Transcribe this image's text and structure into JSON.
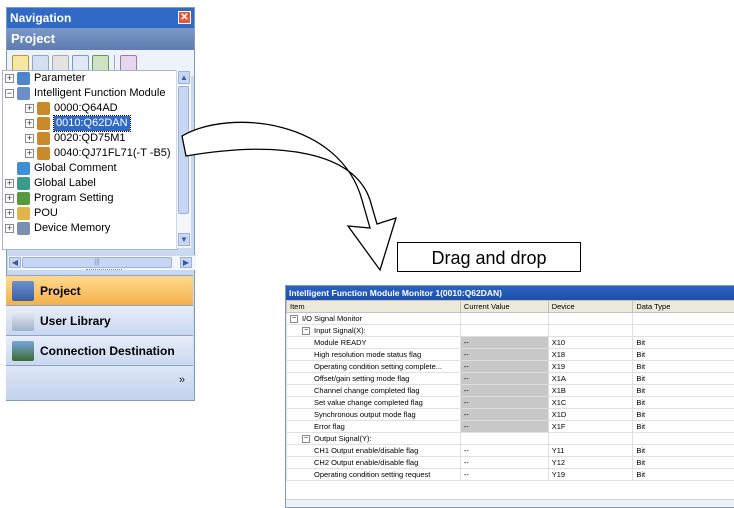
{
  "navigation": {
    "title": "Navigation",
    "section": "Project",
    "tree": [
      {
        "label": "Parameter",
        "level": 0,
        "expander": "+",
        "icon": "parameter-icon"
      },
      {
        "label": "Intelligent Function Module",
        "level": 0,
        "expander": "−",
        "icon": "module-folder-icon"
      },
      {
        "label": "0000:Q64AD",
        "level": 1,
        "expander": "+",
        "icon": "module-icon"
      },
      {
        "label": "0010:Q62DAN",
        "level": 1,
        "expander": "+",
        "icon": "module-icon",
        "selected": true
      },
      {
        "label": "0020:QD75M1",
        "level": 1,
        "expander": "+",
        "icon": "module-icon"
      },
      {
        "label": "0040:QJ71FL71(-T -B5)",
        "level": 1,
        "expander": "+",
        "icon": "module-icon"
      },
      {
        "label": "Global Comment",
        "level": 0,
        "expander": "",
        "icon": "comment-icon"
      },
      {
        "label": "Global Label",
        "level": 0,
        "expander": "+",
        "icon": "label-icon"
      },
      {
        "label": "Program Setting",
        "level": 0,
        "expander": "+",
        "icon": "program-icon"
      },
      {
        "label": "POU",
        "level": 0,
        "expander": "+",
        "icon": "pou-icon"
      },
      {
        "label": "Device Memory",
        "level": 0,
        "expander": "+",
        "icon": "device-memory-icon"
      }
    ],
    "panes": {
      "project": "Project",
      "user_library": "User Library",
      "connection": "Connection Destination"
    },
    "more": "»"
  },
  "drag_label": "Drag and drop",
  "monitor": {
    "title": "Intelligent Function Module Monitor 1(0010:Q62DAN)",
    "columns": [
      "Item",
      "Current Value",
      "Device",
      "Data Type"
    ],
    "rows": [
      {
        "item": "I/O Signal Monitor",
        "indent": 0,
        "exp": "−",
        "value": "",
        "device": "",
        "type": "",
        "grey": false
      },
      {
        "item": "Input Signal(X):",
        "indent": 1,
        "exp": "−",
        "value": "",
        "device": "",
        "type": "",
        "grey": false
      },
      {
        "item": "Module READY",
        "indent": 2,
        "exp": "",
        "value": "--",
        "device": "X10",
        "type": "Bit",
        "grey": true
      },
      {
        "item": "High resolution mode status flag",
        "indent": 2,
        "exp": "",
        "value": "--",
        "device": "X18",
        "type": "Bit",
        "grey": true
      },
      {
        "item": "Operating condition setting complete...",
        "indent": 2,
        "exp": "",
        "value": "--",
        "device": "X19",
        "type": "Bit",
        "grey": true
      },
      {
        "item": "Offset/gain setting mode flag",
        "indent": 2,
        "exp": "",
        "value": "--",
        "device": "X1A",
        "type": "Bit",
        "grey": true
      },
      {
        "item": "Channel change completed flag",
        "indent": 2,
        "exp": "",
        "value": "--",
        "device": "X1B",
        "type": "Bit",
        "grey": true
      },
      {
        "item": "Set value change completed flag",
        "indent": 2,
        "exp": "",
        "value": "--",
        "device": "X1C",
        "type": "Bit",
        "grey": true
      },
      {
        "item": "Synchronous output mode flag",
        "indent": 2,
        "exp": "",
        "value": "--",
        "device": "X1D",
        "type": "Bit",
        "grey": true
      },
      {
        "item": "Error flag",
        "indent": 2,
        "exp": "",
        "value": "--",
        "device": "X1F",
        "type": "Bit",
        "grey": true
      },
      {
        "item": "Output Signal(Y):",
        "indent": 1,
        "exp": "−",
        "value": "",
        "device": "",
        "type": "",
        "grey": false
      },
      {
        "item": "CH1 Output enable/disable flag",
        "indent": 2,
        "exp": "",
        "value": "--",
        "device": "Y11",
        "type": "Bit",
        "grey": false
      },
      {
        "item": "CH2 Output enable/disable flag",
        "indent": 2,
        "exp": "",
        "value": "--",
        "device": "Y12",
        "type": "Bit",
        "grey": false
      },
      {
        "item": "Operating condition setting request",
        "indent": 2,
        "exp": "",
        "value": "--",
        "device": "Y19",
        "type": "Bit",
        "grey": false
      }
    ]
  }
}
